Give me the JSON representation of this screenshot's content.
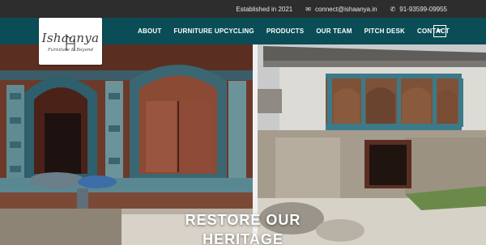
{
  "topbar": {
    "established": "Established in 2021",
    "email": "connect@ishaanya.in",
    "phone": "91-93599-09955",
    "email_icon": "envelope-icon",
    "phone_icon": "phone-icon"
  },
  "logo": {
    "brand": "Ishaanya",
    "tagline": "Furniture & Beyond"
  },
  "nav": {
    "items": [
      "ABOUT",
      "FURNITURE UPCYCLING",
      "PRODUCTS",
      "OUR TEAM",
      "PITCH DESK",
      "CONTACT"
    ],
    "social": "in"
  },
  "hero": {
    "line1": "RESTORE OUR",
    "line2": "HERITAGE"
  },
  "colors": {
    "topbar_bg": "#2d2d2d",
    "nav_bg": "#0b4d57",
    "text_light": "#ffffff"
  }
}
